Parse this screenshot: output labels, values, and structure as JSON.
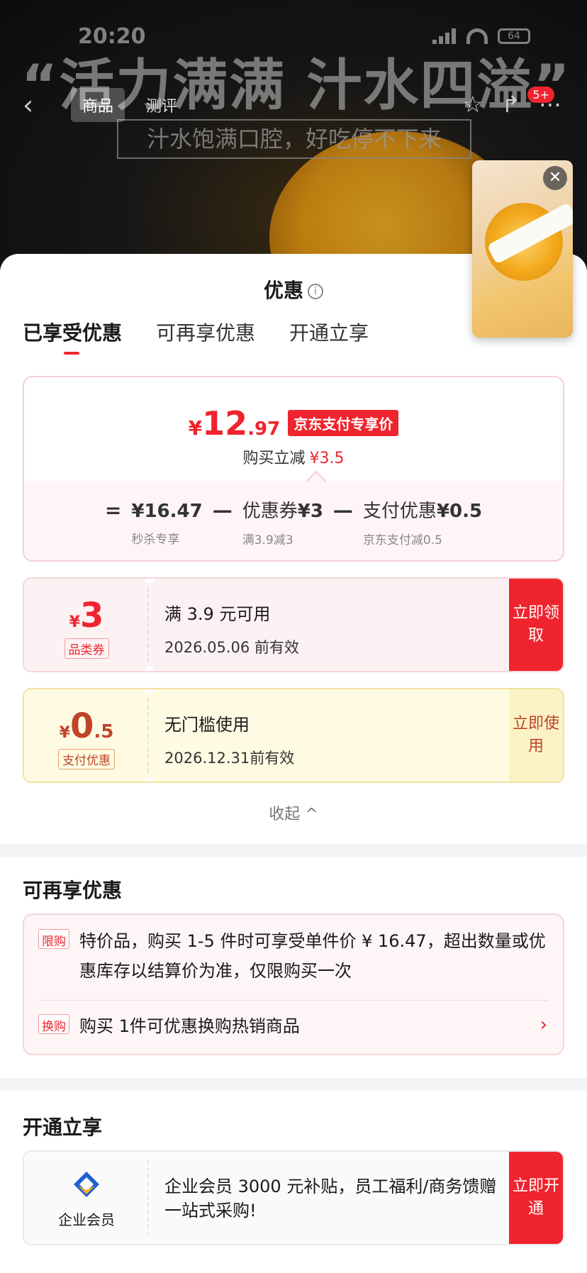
{
  "status": {
    "time": "20:20",
    "battery": "64"
  },
  "banner": {
    "title": "“活力满满 汁水四溢”",
    "subtitle": "汁水饱满口腔，好吃停不下来"
  },
  "nav": {
    "tabs": [
      "商品",
      "测评"
    ],
    "badge": "5+"
  },
  "sheet": {
    "title": "优惠",
    "tabs": [
      "已享受优惠",
      "可再享优惠",
      "开通立享"
    ]
  },
  "summary": {
    "price_yen": "¥",
    "price_int": "12",
    "price_dec": ".97",
    "price_tag": "京东支付专享价",
    "reduce_label": "购买立减",
    "reduce_value": "¥3.5",
    "formula": {
      "eq": "=",
      "base": "¥16.47",
      "base_sub": "秒杀专享",
      "minus1": "—",
      "coupon_label": "优惠券",
      "coupon_value": "¥3",
      "coupon_sub": "满3.9减3",
      "minus2": "—",
      "pay_label": "支付优惠",
      "pay_value": "¥0.5",
      "pay_sub": "京东支付减0.5"
    }
  },
  "coupons": [
    {
      "yen": "¥",
      "num": "3",
      "frac": "",
      "tag": "品类券",
      "condition": "满 3.9 元可用",
      "expiry": "2026.05.06 前有效",
      "button": "立即领取"
    },
    {
      "yen": "¥",
      "num": "0",
      "frac": ".5",
      "tag": "支付优惠",
      "condition": "无门槛使用",
      "expiry": "2026.12.31前有效",
      "button": "立即使用"
    }
  ],
  "collapse": "收起",
  "more": {
    "title": "可再享优惠",
    "rules": [
      {
        "tag": "限购",
        "text": "特价品，购买 1-5 件时可享受单件价 ¥ 16.47，超出数量或优惠库存以结算价为准，仅限购买一次"
      },
      {
        "tag": "换购",
        "text": "购买 1件可优惠换购热销商品"
      }
    ]
  },
  "open": {
    "title": "开通立享",
    "label": "企业会员",
    "text": "企业会员 3000 元补贴，员工福利/商务馈赠一站式采购!",
    "button": "立即开通"
  },
  "colors": {
    "accent": "#f0242e",
    "pay_accent": "#c0432a"
  }
}
